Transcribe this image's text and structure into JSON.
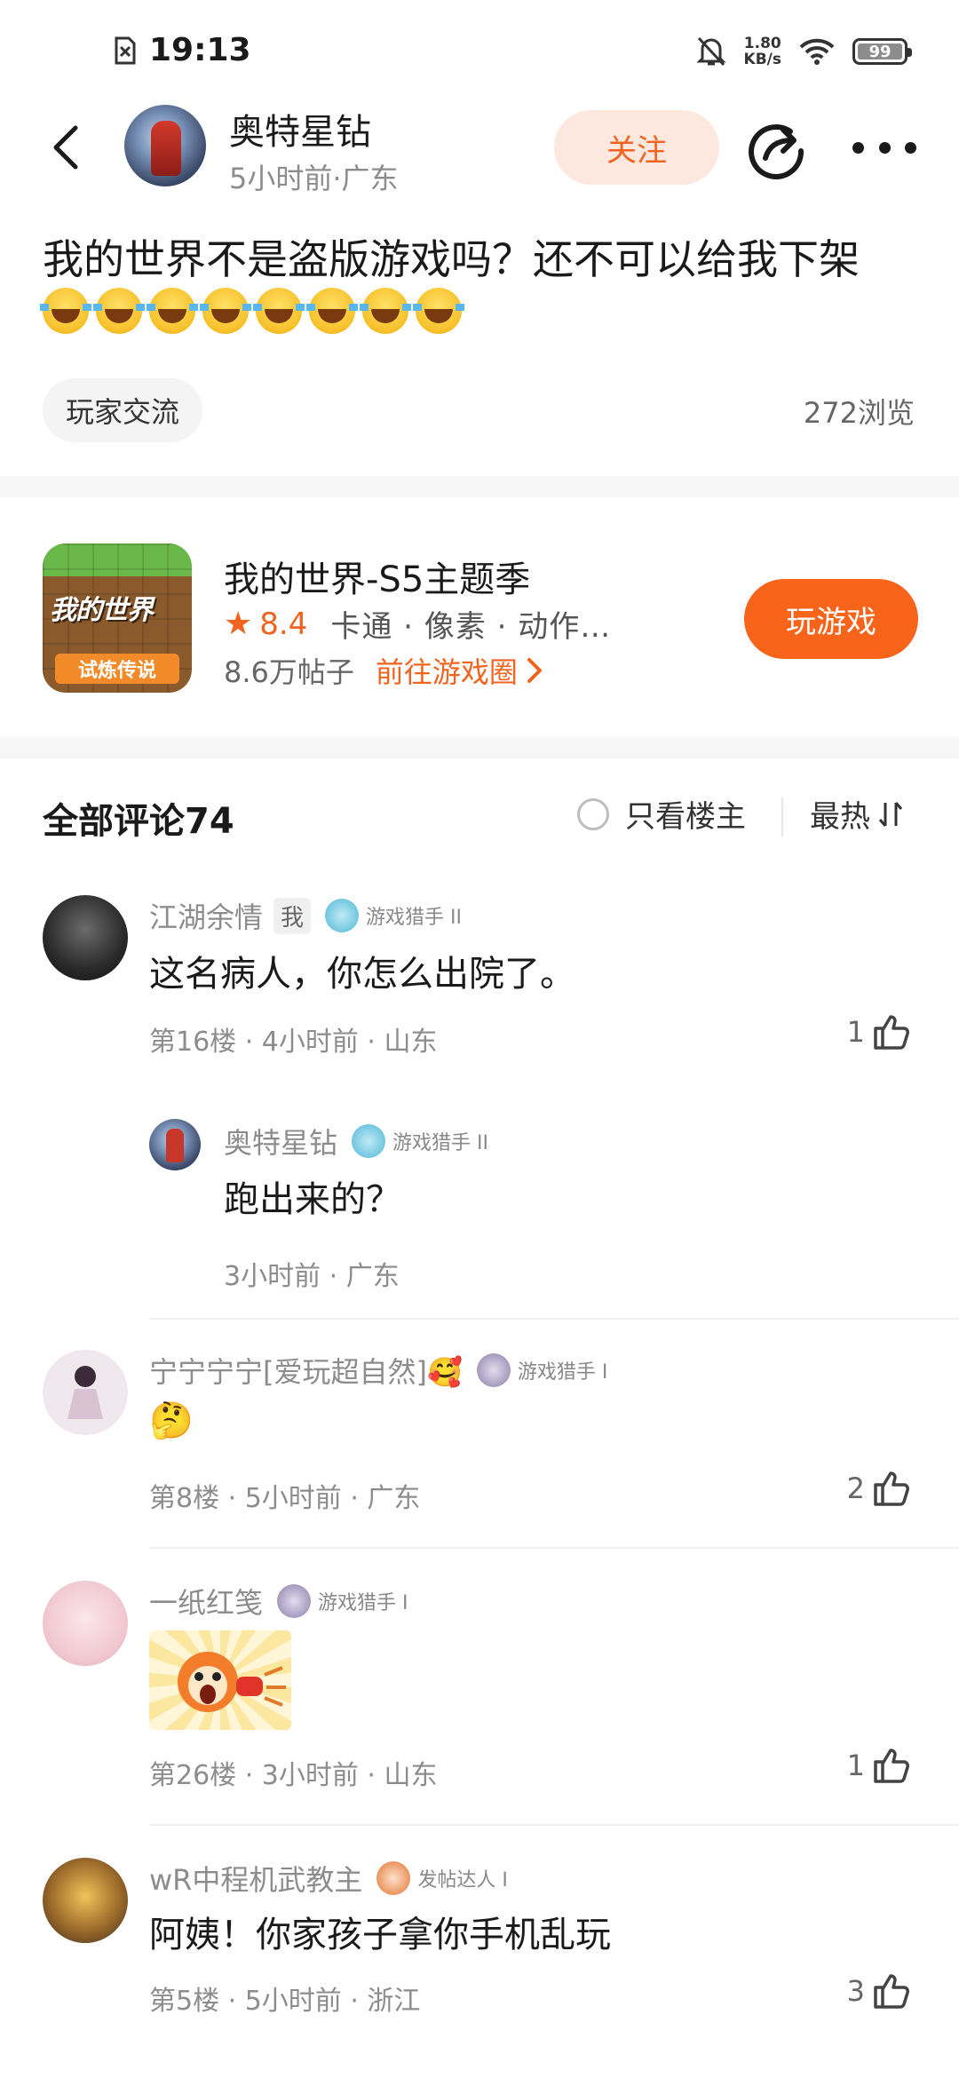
{
  "status_bar": {
    "time": "19:13",
    "net_speed_value": "1.80",
    "net_speed_unit": "KB/s",
    "battery": "99",
    "battery_level": 0.99
  },
  "header": {
    "author_name": "奥特星钻",
    "author_meta": "5小时前·广东",
    "follow_label": "关注"
  },
  "post": {
    "title": "我的世界不是盗版游戏吗？还不可以给我下架",
    "emoji_count": 8,
    "tag": "玩家交流",
    "views": "272浏览"
  },
  "game": {
    "name": "我的世界-S5主题季",
    "icon_title": "我的世界",
    "icon_subtitle": "试炼传说",
    "rating": "8.4",
    "genres": "卡通 · 像素 · 动作…",
    "post_count": "8.6万帖子",
    "goto_label": "前往游戏圈",
    "play_label": "玩游戏"
  },
  "comments_header": {
    "title": "全部评论74",
    "only_op_label": "只看楼主",
    "sort_label": "最热"
  },
  "comments": [
    {
      "name": "江湖余情",
      "me_badge": "我",
      "level": "游戏猎手 II",
      "text": "这名病人，你怎么出院了。",
      "meta": "第16楼 · 4小时前 · 山东",
      "likes": "1",
      "reply": {
        "name": "奥特星钻",
        "level": "游戏猎手 II",
        "text": "跑出来的？",
        "meta": "3小时前 · 广东"
      }
    },
    {
      "name": "宁宁宁宁[爱玩超自然]🥰",
      "level": "游戏猎手 I",
      "text": "🤔",
      "meta": "第8楼 · 5小时前 · 广东",
      "likes": "2"
    },
    {
      "name": "一纸红笺",
      "level": "游戏猎手 I",
      "text": "",
      "meta": "第26楼 · 3小时前 · 山东",
      "likes": "1"
    },
    {
      "name": "wR中程机武教主",
      "level": "发帖达人 I",
      "text": "阿姨！你家孩子拿你手机乱玩",
      "meta": "第5楼 · 5小时前 · 浙江",
      "likes": "3"
    }
  ],
  "colors": {
    "accent": "#f2631f",
    "play_button": "#f7641a",
    "follow_bg": "#fde8df",
    "muted_text": "#8c8c8c",
    "band": "#f6f6f7"
  }
}
